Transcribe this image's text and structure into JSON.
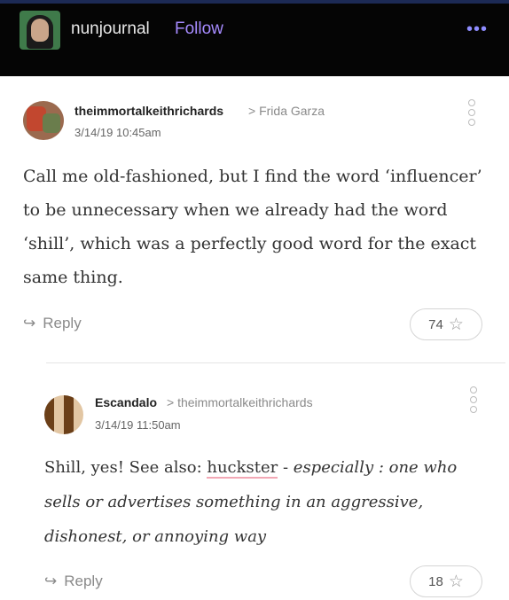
{
  "topbar": {
    "blog_name": "nunjournal",
    "follow_label": "Follow",
    "more_icon": "ellipsis-icon",
    "colors": {
      "background": "#050505",
      "follow": "#a68bff"
    }
  },
  "comments": [
    {
      "author": "theimmortalkeithrichards",
      "reply_to": "Frida Garza",
      "timestamp": "3/14/19 10:45am",
      "body": "Call me old-fashioned, but I find the word ‘influencer’ to be unnecessary when we already had the word ‘shill’, which was a perfectly good word for the exact same thing.",
      "reply_label": "Reply",
      "likes": "74"
    },
    {
      "author": "Escandalo",
      "reply_to": "theimmortalkeithrichards",
      "timestamp": "3/14/19 11:50am",
      "body_prefix": "Shill, yes! See also: ",
      "body_link": "huckster",
      "body_dash": " - ",
      "body_italic": "especially : one who sells or advertises something in an aggressive, dishonest, or annoying way",
      "reply_label": "Reply",
      "likes": "18"
    }
  ]
}
